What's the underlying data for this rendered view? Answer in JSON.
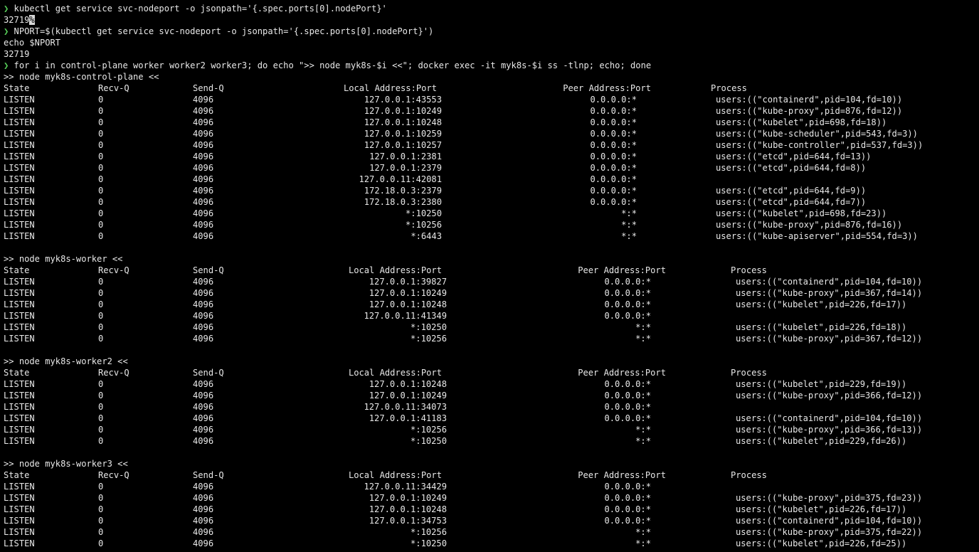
{
  "terminal": {
    "prompt_symbol": "❯",
    "commands": [
      {
        "text": "kubectl get service svc-nodeport -o jsonpath='{.spec.ports[0].nodePort}'",
        "output": [
          "32719"
        ]
      },
      {
        "text": "NPORT=$(kubectl get service svc-nodeport -o jsonpath='{.spec.ports[0].nodePort}')",
        "output": [
          "echo $NPORT",
          "32719"
        ]
      },
      {
        "text": "for i in control-plane worker worker2 worker3; do echo \">> node myk8s-$i <<\"; docker exec -it myk8s-$i ss -tlnp; echo; done",
        "output": []
      }
    ],
    "cursor_char": "%",
    "table_header": [
      "State",
      "Recv-Q",
      "Send-Q",
      "Local Address:Port",
      "Peer Address:Port",
      "Process"
    ],
    "nodes": [
      {
        "heading": ">> node myk8s-control-plane <<",
        "rows": [
          [
            "LISTEN",
            "0",
            "4096",
            "127.0.0.1:43553",
            "0.0.0.0:*",
            "users:((\"containerd\",pid=104,fd=10))"
          ],
          [
            "LISTEN",
            "0",
            "4096",
            "127.0.0.1:10249",
            "0.0.0.0:*",
            "users:((\"kube-proxy\",pid=876,fd=12))"
          ],
          [
            "LISTEN",
            "0",
            "4096",
            "127.0.0.1:10248",
            "0.0.0.0:*",
            "users:((\"kubelet\",pid=698,fd=18))"
          ],
          [
            "LISTEN",
            "0",
            "4096",
            "127.0.0.1:10259",
            "0.0.0.0:*",
            "users:((\"kube-scheduler\",pid=543,fd=3))"
          ],
          [
            "LISTEN",
            "0",
            "4096",
            "127.0.0.1:10257",
            "0.0.0.0:*",
            "users:((\"kube-controller\",pid=537,fd=3))"
          ],
          [
            "LISTEN",
            "0",
            "4096",
            "127.0.0.1:2381",
            "0.0.0.0:*",
            "users:((\"etcd\",pid=644,fd=13))"
          ],
          [
            "LISTEN",
            "0",
            "4096",
            "127.0.0.1:2379",
            "0.0.0.0:*",
            "users:((\"etcd\",pid=644,fd=8))"
          ],
          [
            "LISTEN",
            "0",
            "4096",
            "127.0.0.11:42081",
            "0.0.0.0:*",
            ""
          ],
          [
            "LISTEN",
            "0",
            "4096",
            "172.18.0.3:2379",
            "0.0.0.0:*",
            "users:((\"etcd\",pid=644,fd=9))"
          ],
          [
            "LISTEN",
            "0",
            "4096",
            "172.18.0.3:2380",
            "0.0.0.0:*",
            "users:((\"etcd\",pid=644,fd=7))"
          ],
          [
            "LISTEN",
            "0",
            "4096",
            "*:10250",
            "*:*",
            "users:((\"kubelet\",pid=698,fd=23))"
          ],
          [
            "LISTEN",
            "0",
            "4096",
            "*:10256",
            "*:*",
            "users:((\"kube-proxy\",pid=876,fd=16))"
          ],
          [
            "LISTEN",
            "0",
            "4096",
            "*:6443",
            "*:*",
            "users:((\"kube-apiserver\",pid=554,fd=3))"
          ]
        ]
      },
      {
        "heading": ">> node myk8s-worker <<",
        "rows": [
          [
            "LISTEN",
            "0",
            "4096",
            "127.0.0.1:39827",
            "0.0.0.0:*",
            "users:((\"containerd\",pid=104,fd=10))"
          ],
          [
            "LISTEN",
            "0",
            "4096",
            "127.0.0.1:10249",
            "0.0.0.0:*",
            "users:((\"kube-proxy\",pid=367,fd=14))"
          ],
          [
            "LISTEN",
            "0",
            "4096",
            "127.0.0.1:10248",
            "0.0.0.0:*",
            "users:((\"kubelet\",pid=226,fd=17))"
          ],
          [
            "LISTEN",
            "0",
            "4096",
            "127.0.0.11:41349",
            "0.0.0.0:*",
            ""
          ],
          [
            "LISTEN",
            "0",
            "4096",
            "*:10250",
            "*:*",
            "users:((\"kubelet\",pid=226,fd=18))"
          ],
          [
            "LISTEN",
            "0",
            "4096",
            "*:10256",
            "*:*",
            "users:((\"kube-proxy\",pid=367,fd=12))"
          ]
        ]
      },
      {
        "heading": ">> node myk8s-worker2 <<",
        "rows": [
          [
            "LISTEN",
            "0",
            "4096",
            "127.0.0.1:10248",
            "0.0.0.0:*",
            "users:((\"kubelet\",pid=229,fd=19))"
          ],
          [
            "LISTEN",
            "0",
            "4096",
            "127.0.0.1:10249",
            "0.0.0.0:*",
            "users:((\"kube-proxy\",pid=366,fd=12))"
          ],
          [
            "LISTEN",
            "0",
            "4096",
            "127.0.0.11:34073",
            "0.0.0.0:*",
            ""
          ],
          [
            "LISTEN",
            "0",
            "4096",
            "127.0.0.1:41183",
            "0.0.0.0:*",
            "users:((\"containerd\",pid=104,fd=10))"
          ],
          [
            "LISTEN",
            "0",
            "4096",
            "*:10256",
            "*:*",
            "users:((\"kube-proxy\",pid=366,fd=13))"
          ],
          [
            "LISTEN",
            "0",
            "4096",
            "*:10250",
            "*:*",
            "users:((\"kubelet\",pid=229,fd=26))"
          ]
        ]
      },
      {
        "heading": ">> node myk8s-worker3 <<",
        "rows": [
          [
            "LISTEN",
            "0",
            "4096",
            "127.0.0.11:34429",
            "0.0.0.0:*",
            ""
          ],
          [
            "LISTEN",
            "0",
            "4096",
            "127.0.0.1:10249",
            "0.0.0.0:*",
            "users:((\"kube-proxy\",pid=375,fd=23))"
          ],
          [
            "LISTEN",
            "0",
            "4096",
            "127.0.0.1:10248",
            "0.0.0.0:*",
            "users:((\"kubelet\",pid=226,fd=17))"
          ],
          [
            "LISTEN",
            "0",
            "4096",
            "127.0.0.1:34753",
            "0.0.0.0:*",
            "users:((\"containerd\",pid=104,fd=10))"
          ],
          [
            "LISTEN",
            "0",
            "4096",
            "*:10256",
            "*:*",
            "users:((\"kube-proxy\",pid=375,fd=22))"
          ],
          [
            "LISTEN",
            "0",
            "4096",
            "*:10250",
            "*:*",
            "users:((\"kubelet\",pid=226,fd=25))"
          ]
        ]
      }
    ]
  }
}
